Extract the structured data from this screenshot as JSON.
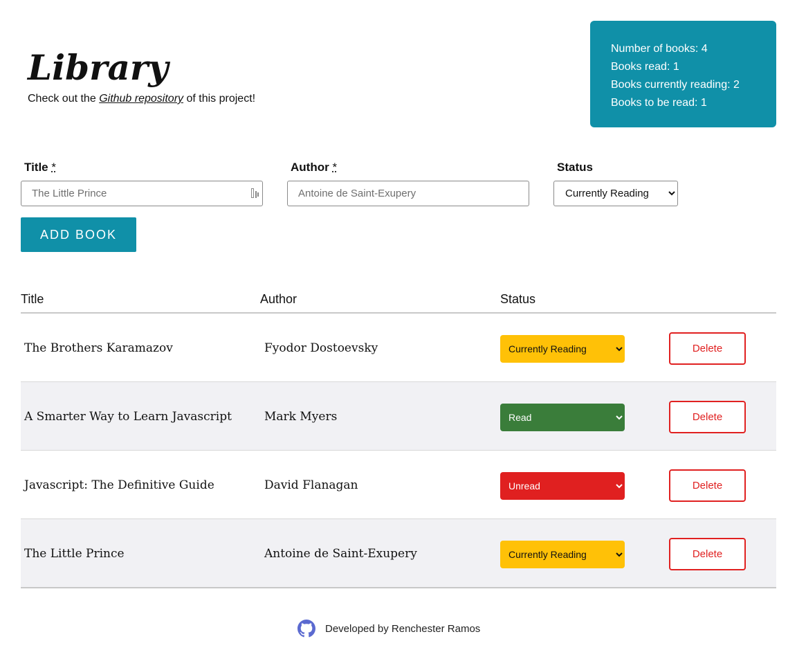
{
  "header": {
    "title": "Library",
    "intro_prefix": "Check out the",
    "repo_link": "Github repository",
    "intro_suffix": "of this project!"
  },
  "stats": {
    "total": "Number of books: 4",
    "read": "Books read: 1",
    "reading": "Books currently reading: 2",
    "unread": "Books to be read: 1"
  },
  "form": {
    "title_label": "Title",
    "author_label": "Author",
    "required_mark": "*",
    "status_label": "Status",
    "title_placeholder": "The Little Prince",
    "author_placeholder": "Antoine de Saint-Exupery",
    "status_value": "Currently Reading",
    "status_options": [
      "Currently Reading",
      "Read",
      "Unread"
    ],
    "add_button": "Add Book"
  },
  "table": {
    "headers": [
      "Title",
      "Author",
      "Status"
    ],
    "delete_label": "Delete",
    "rows": [
      {
        "title": "The Brothers Karamazov",
        "author": "Fyodor Dostoevsky",
        "status": "Currently Reading",
        "status_color": "#ffc107"
      },
      {
        "title": "A Smarter Way to Learn Javascript",
        "author": "Mark Myers",
        "status": "Read",
        "status_color": "#3a7d3a"
      },
      {
        "title": "Javascript: The Definitive Guide",
        "author": "David Flanagan",
        "status": "Unread",
        "status_color": "#e02020"
      },
      {
        "title": "The Little Prince",
        "author": "Antoine de Saint-Exupery",
        "status": "Currently Reading",
        "status_color": "#ffc107"
      }
    ]
  },
  "footer": {
    "icon": "github-icon",
    "credit": "Developed by Renchester Ramos"
  },
  "colors": {
    "accent": "#1090a8",
    "delete": "#e02020"
  }
}
